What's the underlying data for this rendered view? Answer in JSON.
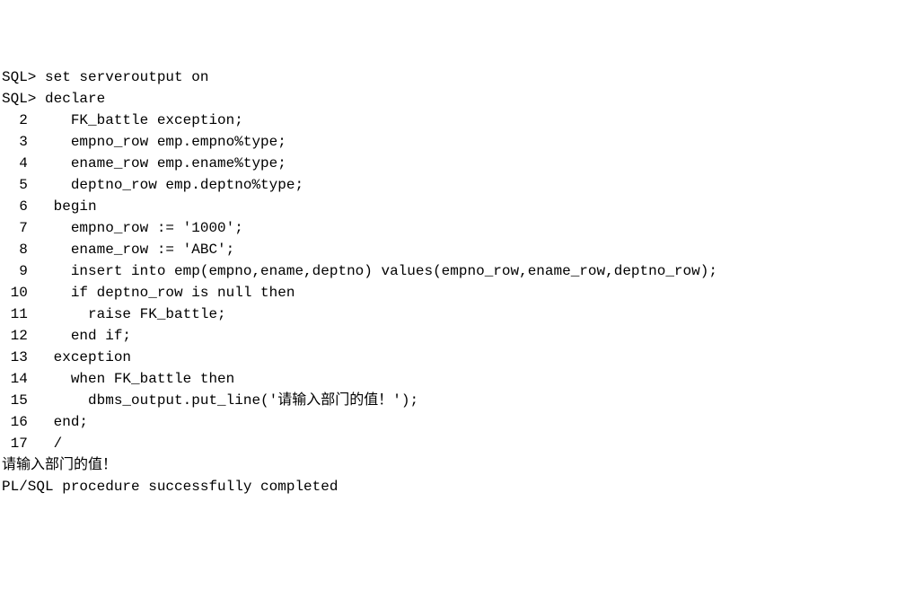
{
  "terminal": {
    "prompt": "SQL>",
    "lines": [
      {
        "prompt": "SQL>",
        "code": " set serveroutput on"
      },
      {
        "prompt": "SQL>",
        "code": " declare"
      },
      {
        "num": "2",
        "code": "    FK_battle exception;"
      },
      {
        "num": "3",
        "code": "    empno_row emp.empno%type;"
      },
      {
        "num": "4",
        "code": "    ename_row emp.ename%type;"
      },
      {
        "num": "5",
        "code": "    deptno_row emp.deptno%type;"
      },
      {
        "num": "6",
        "code": "  begin"
      },
      {
        "num": "7",
        "code": "    empno_row := '1000';"
      },
      {
        "num": "8",
        "code": "    ename_row := 'ABC';"
      },
      {
        "num": "9",
        "code": "    insert into emp(empno,ename,deptno) values(empno_row,ename_row,deptno_row);"
      },
      {
        "num": "10",
        "code": "    if deptno_row is null then"
      },
      {
        "num": "11",
        "code": "      raise FK_battle;"
      },
      {
        "num": "12",
        "code": "    end if;"
      },
      {
        "num": "13",
        "code": "  exception"
      },
      {
        "num": "14",
        "code": "    when FK_battle then"
      },
      {
        "num": "15",
        "code": "      dbms_output.put_line('请输入部门的值！');"
      },
      {
        "num": "16",
        "code": "  end;"
      },
      {
        "num": "17",
        "code": "  /"
      }
    ],
    "output": [
      "请输入部门的值！",
      "PL/SQL procedure successfully completed"
    ]
  }
}
